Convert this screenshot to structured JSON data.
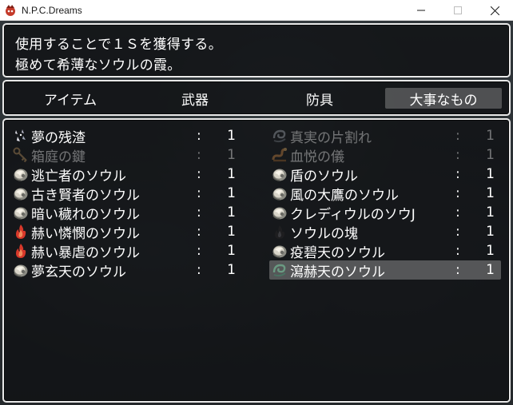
{
  "window": {
    "title": "N.P.C.Dreams",
    "minimize_icon": "minimize-icon",
    "maximize_icon": "maximize-icon",
    "close_icon": "close-icon"
  },
  "help": {
    "line1": "使用することで１Ｓを獲得する。",
    "line2": "極めて希薄なソウルの霞。"
  },
  "categories": [
    {
      "label": "アイテム",
      "selected": false
    },
    {
      "label": "武器",
      "selected": false
    },
    {
      "label": "防具",
      "selected": false
    },
    {
      "label": "大事なもの",
      "selected": true
    }
  ],
  "items": [
    {
      "name": "夢の残渣",
      "colon": ":",
      "qty": "1",
      "icon": "sparkle-shards-icon",
      "enabled": true,
      "selected": false
    },
    {
      "name": "真実の片割れ",
      "colon": ":",
      "qty": "1",
      "icon": "swirl-icon",
      "enabled": false,
      "selected": false
    },
    {
      "name": "箱庭の鍵",
      "colon": ":",
      "qty": "1",
      "icon": "key-icon",
      "enabled": false,
      "selected": false
    },
    {
      "name": "血悦の儀",
      "colon": ":",
      "qty": "1",
      "icon": "serpent-icon",
      "enabled": false,
      "selected": false
    },
    {
      "name": "逃亡者のソウル",
      "colon": ":",
      "qty": "1",
      "icon": "soul-icon",
      "enabled": true,
      "selected": false
    },
    {
      "name": "盾のソウル",
      "colon": ":",
      "qty": "1",
      "icon": "soul-icon",
      "enabled": true,
      "selected": false
    },
    {
      "name": "古き賢者のソウル",
      "colon": ":",
      "qty": "1",
      "icon": "soul-icon",
      "enabled": true,
      "selected": false
    },
    {
      "name": "風の大鷹のソウル",
      "colon": ":",
      "qty": "1",
      "icon": "soul-icon",
      "enabled": true,
      "selected": false
    },
    {
      "name": "暗い穢れのソウル",
      "colon": ":",
      "qty": "1",
      "icon": "soul-icon",
      "enabled": true,
      "selected": false
    },
    {
      "name": "クレディウルのソウJ",
      "colon": ":",
      "qty": "1",
      "icon": "soul-icon",
      "enabled": true,
      "selected": false
    },
    {
      "name": "赫い憐憫のソウル",
      "colon": ":",
      "qty": "1",
      "icon": "red-flame-icon",
      "enabled": true,
      "selected": false
    },
    {
      "name": "ソウルの塊",
      "colon": ":",
      "qty": "1",
      "icon": "dark-flame-icon",
      "enabled": true,
      "selected": false
    },
    {
      "name": "赫い暴虐のソウル",
      "colon": ":",
      "qty": "1",
      "icon": "red-flame-icon",
      "enabled": true,
      "selected": false
    },
    {
      "name": "疫碧天のソウル",
      "colon": ":",
      "qty": "1",
      "icon": "soul-icon",
      "enabled": true,
      "selected": false
    },
    {
      "name": "夢玄天のソウル",
      "colon": ":",
      "qty": "1",
      "icon": "soul-icon",
      "enabled": true,
      "selected": false
    },
    {
      "name": "瀉赫天のソウル",
      "colon": ":",
      "qty": "1",
      "icon": "green-swirl-icon",
      "enabled": true,
      "selected": true
    }
  ]
}
